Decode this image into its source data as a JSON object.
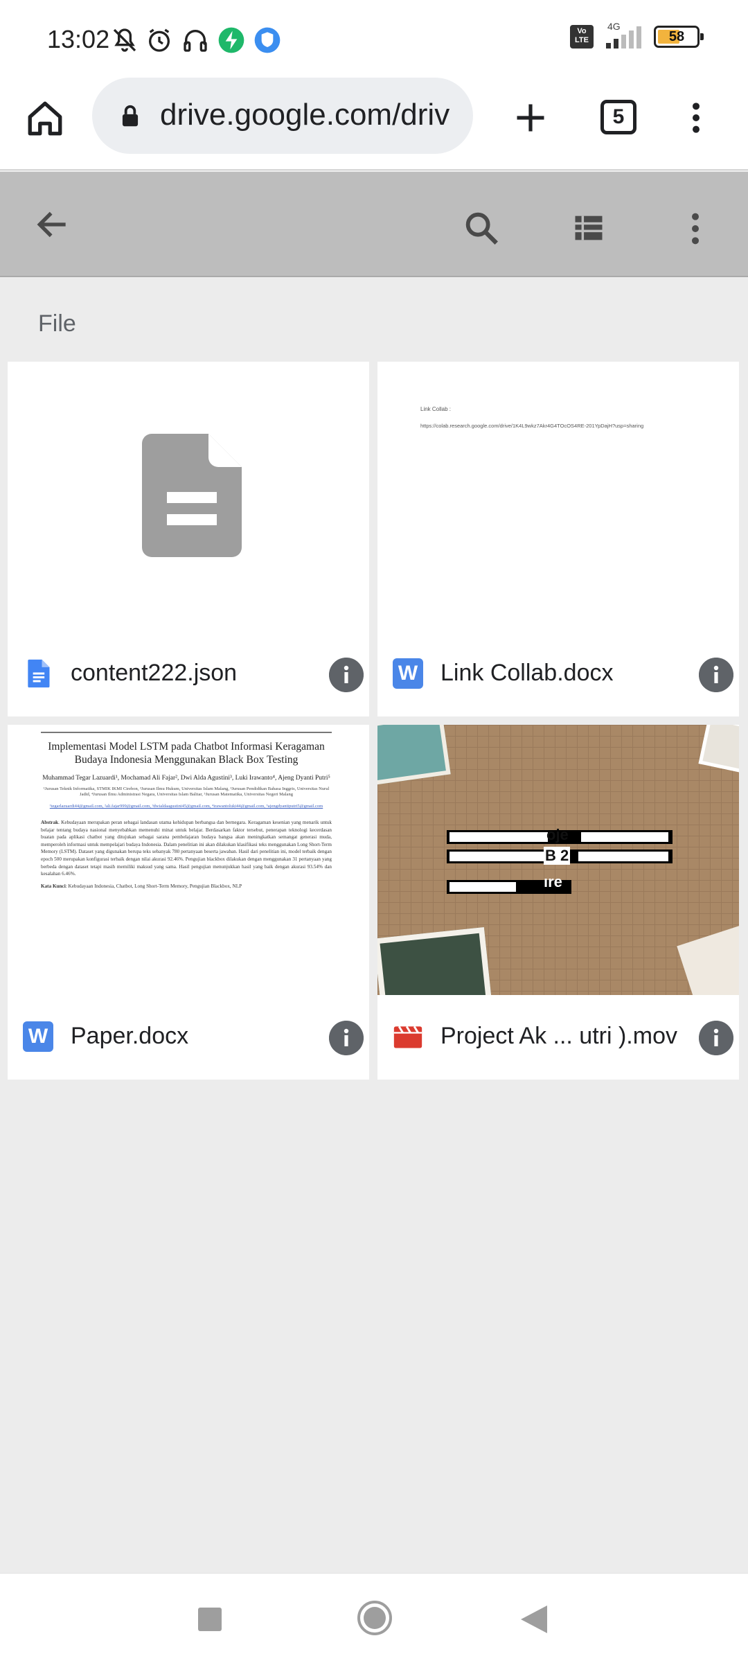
{
  "status_bar": {
    "time": "13:02",
    "network": "4G",
    "volte_label": "Vo LTE",
    "battery_level": "58"
  },
  "browser": {
    "url": "drive.google.com/driv",
    "tab_count": "5"
  },
  "drive": {
    "section_label": "File",
    "files": [
      {
        "name": "content222.json",
        "type_icon": "google-docs-icon"
      },
      {
        "name": "Link Collab.docx",
        "type_icon": "word-icon",
        "type_letter": "W",
        "preview_line1": "Link Collab :",
        "preview_line2": "https://colab.research.google.com/drive/1K4L9wkz7Akr4G4TOcOS4RE-201YpDajH?usp=sharing"
      },
      {
        "name": "Paper.docx",
        "type_icon": "word-icon",
        "type_letter": "W",
        "preview": {
          "title": "Implementasi Model LSTM pada Chatbot Informasi Keragaman Budaya Indonesia Menggunakan Black Box Testing",
          "authors": "Muhammad Tegar Lazuardi¹, Mochamad Ali Fajar², Dwi Alda Agustini³, Luki Irawanto⁴, Ajeng Dyanti Putri⁵",
          "affiliations": "¹Jurusan Teknik Informatika, STMIK IKMI Cirebon, ²Jurusan Ilmu Hukum, Universitas Islam Malang, ³Jurusan Pendidikan Bahasa Inggris, Universitas Nurul Jadid, ⁴Jurusan Ilmu Administrasi Negara, Universitas Islam Balitar, ⁵Jurusan Matematika, Universitas Negeri Malang",
          "emails": "¹tegarlazuardi44@gmail.com, ²ali.fajar999@gmail.com, ³dwialdaagustini45@gmail.com, ⁴irawantoluki44@gmail.com, ⁵ajengdyantiputri5@gmail.com",
          "abstract_label": "Abstrak",
          "abstract": ". Kebudayaan merupakan peran sebagai landasan utama kehidupan berbangsa dan bernegara. Keragaman kesenian yang menarik untuk belajar tentang budaya nasional menyebabkan memenuhi minat untuk belajar. Berdasarkan faktor tersebut, penerapan teknologi kecerdasan buatan pada aplikasi chatbot yang ditujukan sebagai sarana pembelajaran budaya bangsa akan meningkatkan semangat generasi muda, memperoleh informasi untuk mempelajari budaya Indonesia. Dalam penelitian ini akan dilakukan klasifikasi teks menggunakan Long Short-Term Memory (LSTM). Dataset yang digunakan berupa teks sebanyak 780 pertanyaan beserta jawaban. Hasil dari penelitian ini, model terbaik dengan epoch 500 merupakan konfigurasi terbaik dengan nilai akurasi 92.46%. Pengujian blackbox dilakukan dengan menggunakan 31 pertanyaan yang berbeda dengan dataset tetapi masih memiliki maksud yang sama. Hasil pengujian menunjukkan hasil yang baik dengan akurasi 93.54% dan kesalahan 6.46%.",
          "keywords_label": "Kata Kunci",
          "keywords": ": Kebudayaan Indonesia, Chatbot, Long Short-Term Memory, Pengujian Blackbox, NLP"
        }
      },
      {
        "name": "Project Ak ... utri ).mov",
        "type_icon": "video-icon",
        "preview_fragments": [
          "oje",
          "B 2",
          "ıre"
        ]
      }
    ]
  }
}
